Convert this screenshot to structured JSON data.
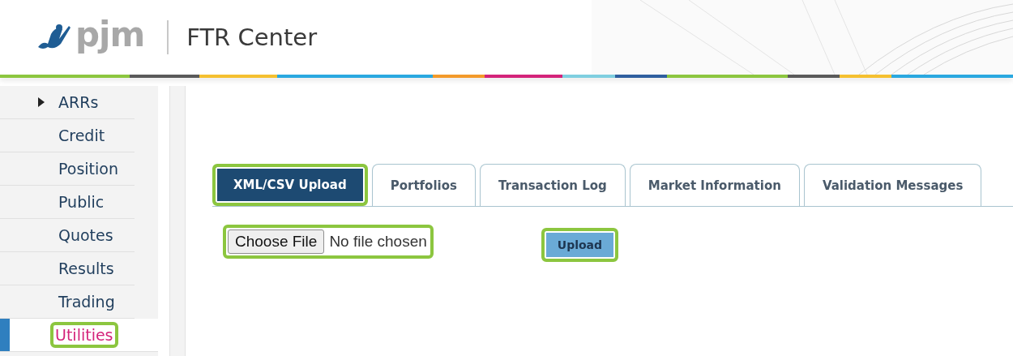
{
  "header": {
    "logo_text": "pjm",
    "title": "FTR Center"
  },
  "sidebar": {
    "items": [
      {
        "label": "ARRs",
        "kind": "expandable",
        "expanded": false,
        "selected": false,
        "highlighted": false
      },
      {
        "label": "Credit",
        "kind": "link",
        "selected": false,
        "highlighted": false
      },
      {
        "label": "Position",
        "kind": "link",
        "selected": false,
        "highlighted": false
      },
      {
        "label": "Public",
        "kind": "link",
        "selected": false,
        "highlighted": false
      },
      {
        "label": "Quotes",
        "kind": "link",
        "selected": false,
        "highlighted": false
      },
      {
        "label": "Results",
        "kind": "link",
        "selected": false,
        "highlighted": false
      },
      {
        "label": "Trading",
        "kind": "link",
        "selected": false,
        "highlighted": false
      },
      {
        "label": "Utilities",
        "kind": "link",
        "selected": true,
        "highlighted": true
      }
    ]
  },
  "tabs": [
    {
      "label": "XML/CSV Upload",
      "selected": true,
      "highlighted": true
    },
    {
      "label": "Portfolios",
      "selected": false,
      "highlighted": false
    },
    {
      "label": "Transaction Log",
      "selected": false,
      "highlighted": false
    },
    {
      "label": "Market Information",
      "selected": false,
      "highlighted": false
    },
    {
      "label": "Validation Messages",
      "selected": false,
      "highlighted": false
    }
  ],
  "file_input": {
    "button": "Choose File",
    "status": "No file chosen",
    "highlighted": true
  },
  "upload_button": {
    "label": "Upload",
    "highlighted": true
  }
}
